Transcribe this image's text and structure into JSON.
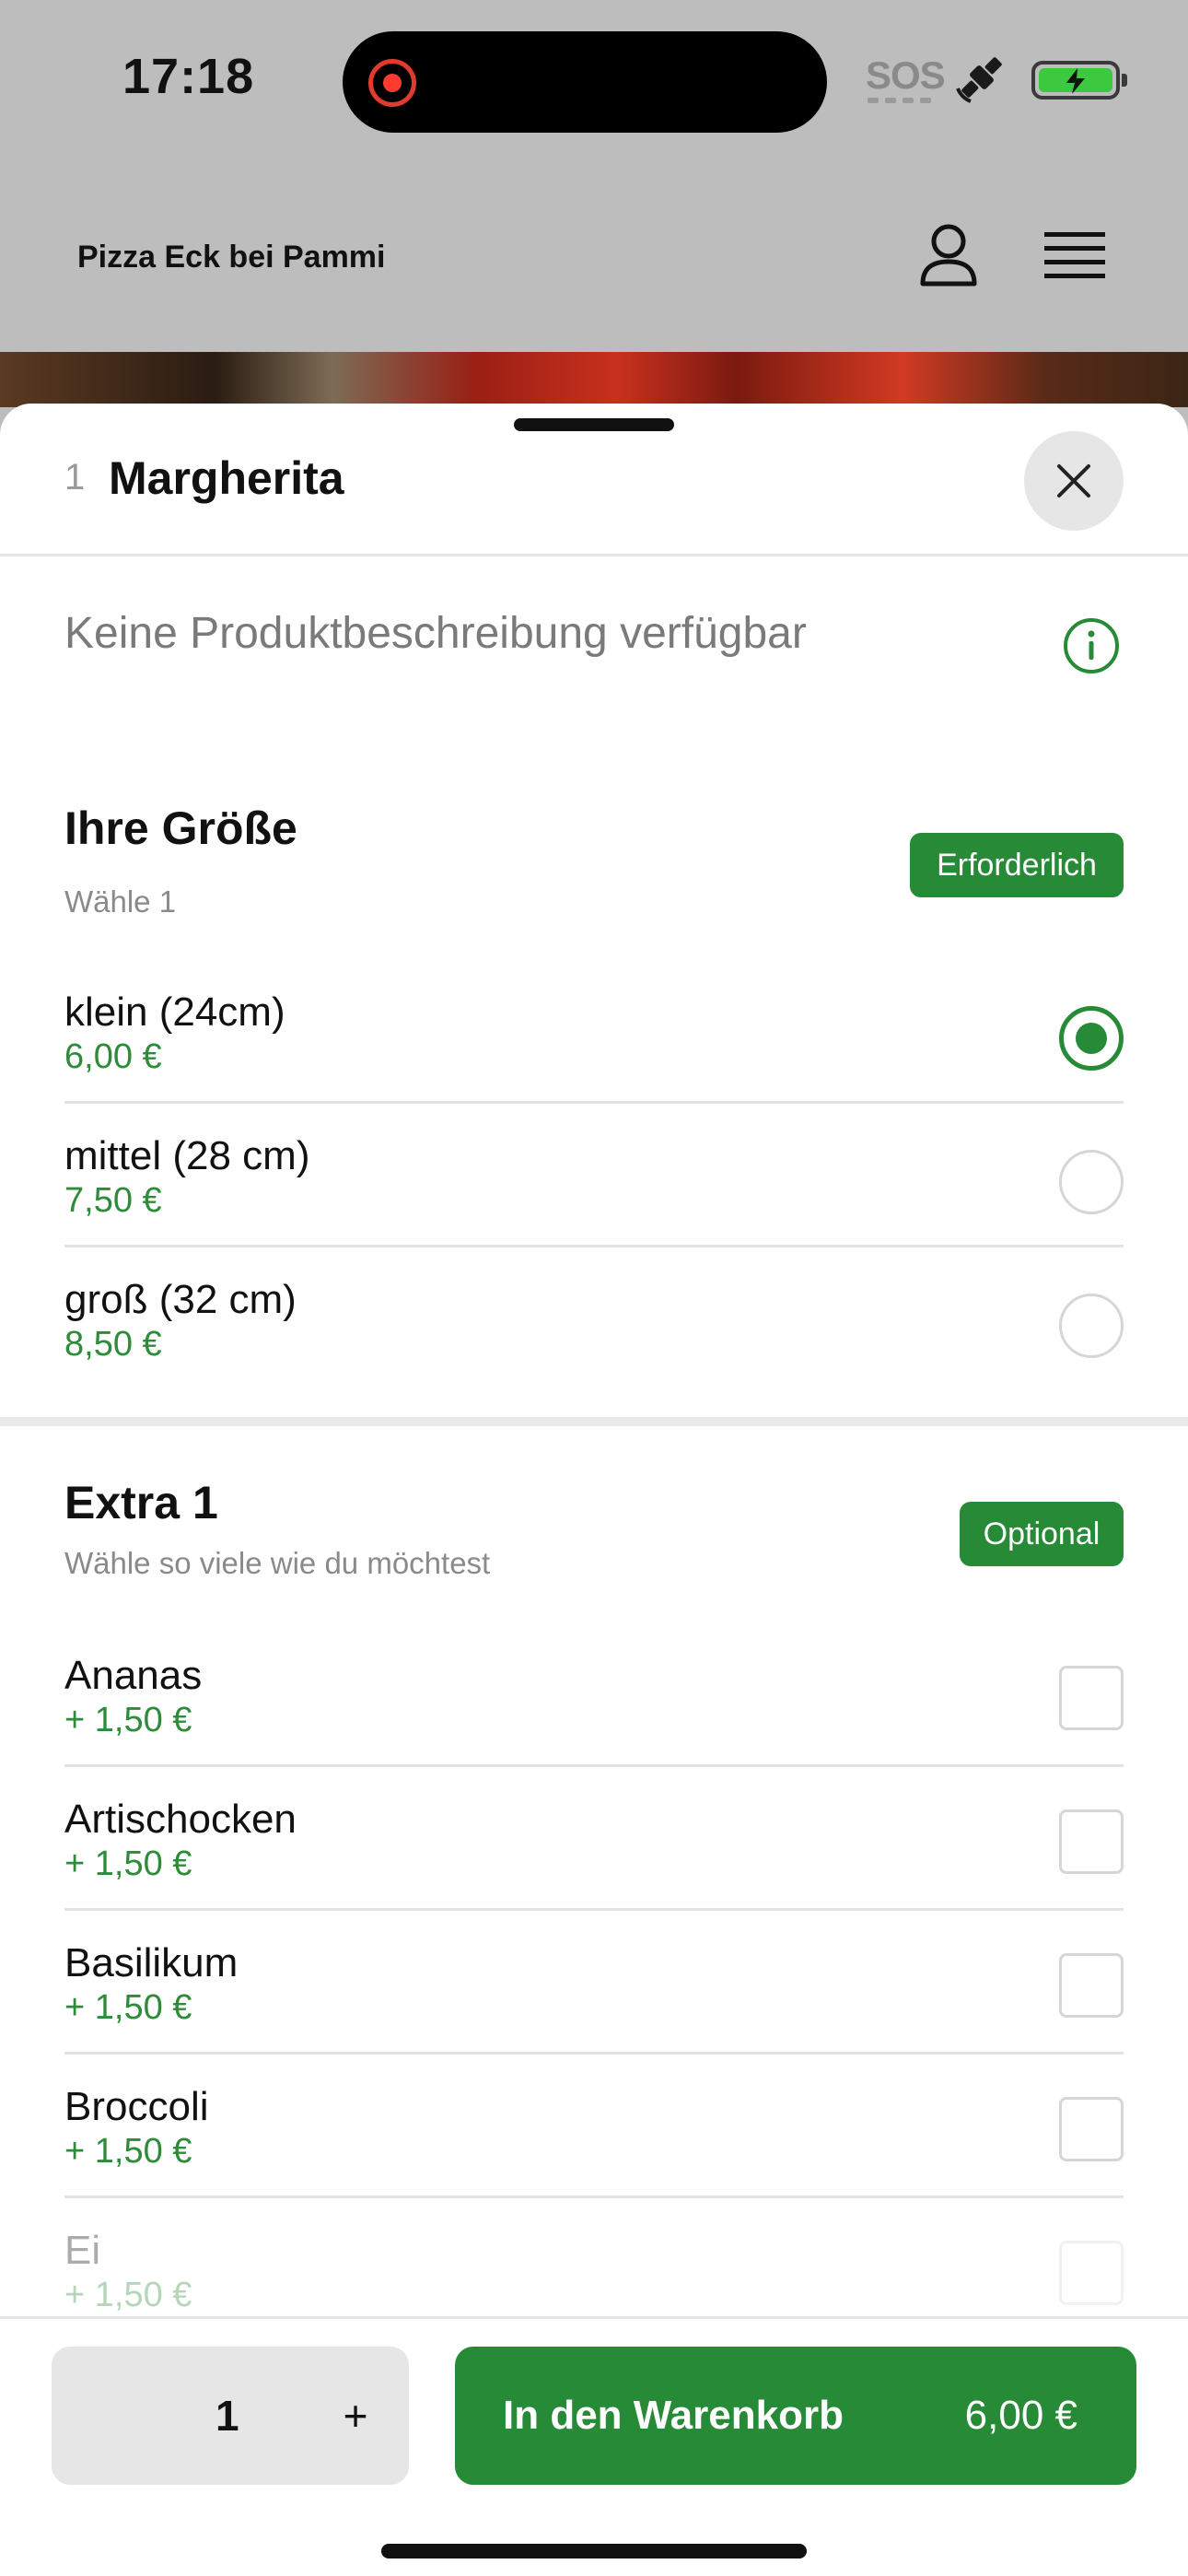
{
  "status_bar": {
    "time": "17:18",
    "sos": "SOS"
  },
  "header": {
    "brand": "Pizza Eck bei Pammi"
  },
  "product": {
    "number": "1",
    "name": "Margherita",
    "description": "Keine Produktbeschreibung verfügbar"
  },
  "size_group": {
    "title": "Ihre Größe",
    "subtitle": "Wähle 1",
    "badge": "Erforderlich",
    "options": [
      {
        "name": "klein (24cm)",
        "price": "6,00 €",
        "selected": true
      },
      {
        "name": "mittel (28 cm)",
        "price": "7,50 €",
        "selected": false
      },
      {
        "name": "groß (32 cm)",
        "price": "8,50 €",
        "selected": false
      }
    ]
  },
  "extra_group": {
    "title": "Extra 1",
    "subtitle": "Wähle so viele wie du möchtest",
    "badge": "Optional",
    "options": [
      {
        "name": "Ananas",
        "price": "+ 1,50 €",
        "checked": false
      },
      {
        "name": "Artischocken",
        "price": "+ 1,50 €",
        "checked": false
      },
      {
        "name": "Basilikum",
        "price": "+ 1,50 €",
        "checked": false
      },
      {
        "name": "Broccoli",
        "price": "+ 1,50 €",
        "checked": false
      },
      {
        "name": "Ei",
        "price": "+ 1,50 €",
        "checked": false
      }
    ]
  },
  "footer": {
    "quantity": "1",
    "plus": "+",
    "add_to_cart": "In den Warenkorb",
    "total": "6,00 €"
  },
  "colors": {
    "accent": "#268a36",
    "price": "#2e8b3a",
    "header_bg": "#bdbdbd"
  }
}
